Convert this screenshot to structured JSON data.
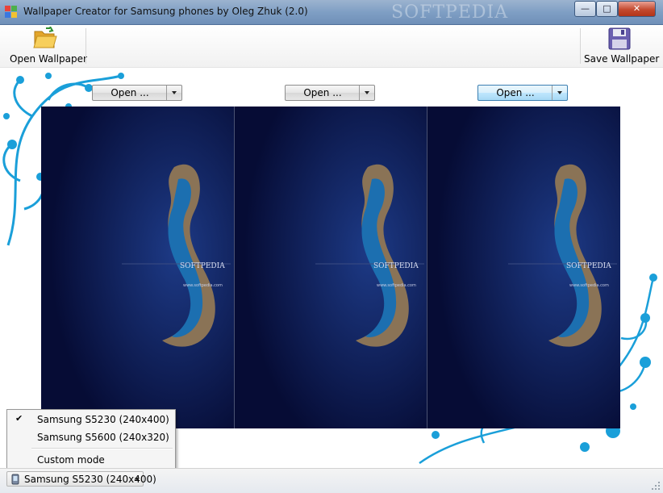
{
  "window": {
    "title": "Wallpaper Creator for Samsung phones by Oleg Zhuk (2.0)",
    "watermark": "SOFTPEDIA",
    "minimize_glyph": "—",
    "maximize_glyph": "□",
    "close_glyph": "✕"
  },
  "toolbar": {
    "open_label": "Open Wallpaper",
    "open_icon": "folder-open-icon",
    "save_label": "Save Wallpaper",
    "save_icon": "floppy-disk-icon"
  },
  "panels": [
    {
      "open_label": "Open ...",
      "logo_text": "SOFTPEDIA",
      "url_text": "www.softpedia.com"
    },
    {
      "open_label": "Open ...",
      "logo_text": "SOFTPEDIA",
      "url_text": "www.softpedia.com"
    },
    {
      "open_label": "Open ...",
      "logo_text": "SOFTPEDIA",
      "url_text": "www.softpedia.com"
    }
  ],
  "menu": {
    "items": [
      {
        "label": "Samsung S5230 (240x400)",
        "checked": true
      },
      {
        "label": "Samsung S5600 (240x320)",
        "checked": false
      },
      {
        "label": "Custom mode",
        "checked": false
      }
    ],
    "check_glyph": "✔"
  },
  "statusbar": {
    "device_selected": "Samsung S5230 (240x400)"
  },
  "colors": {
    "accent_floral": "#1a9fd9",
    "preview_bg": "#0b1446",
    "title_bar": "#7f9fc4"
  }
}
